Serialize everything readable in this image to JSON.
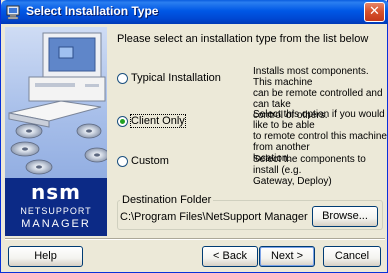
{
  "window": {
    "title": "Select Installation Type",
    "close_glyph": "✕"
  },
  "brand": {
    "logo_main": "nsm",
    "logo_line1": "NETSUPPORT",
    "logo_line2": "MANAGER"
  },
  "prompt": "Please select an installation type from the list below",
  "options": [
    {
      "label": "Typical Installation",
      "checked": false,
      "desc": [
        "Installs most components. This machine",
        "can be remote controlled and can take",
        "control of others."
      ]
    },
    {
      "label": "Client Only",
      "checked": true,
      "desc": [
        "Select this option if you would like to be able",
        "to remote control this machine from another",
        "location."
      ]
    },
    {
      "label": "Custom",
      "checked": false,
      "desc": [
        "Select the components to install (e.g.",
        "Gateway, Deploy)"
      ]
    }
  ],
  "destination": {
    "title": "Destination Folder",
    "path": "C:\\Program Files\\NetSupport Manager",
    "browse_label": "Browse..."
  },
  "buttons": {
    "help": "Help",
    "back": "< Back",
    "next": "Next >",
    "cancel": "Cancel"
  }
}
